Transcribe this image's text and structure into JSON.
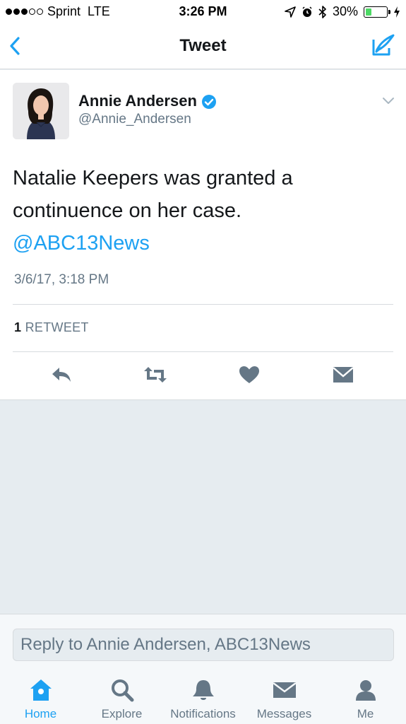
{
  "status_bar": {
    "carrier": "Sprint",
    "network": "LTE",
    "time": "3:26 PM",
    "battery_percent": "30%",
    "battery_level": 0.3,
    "signal_bars_on": 3,
    "signal_bars_total": 5
  },
  "nav": {
    "title": "Tweet",
    "back_icon": "chevron-left-icon",
    "compose_icon": "compose-tweet-icon"
  },
  "tweet": {
    "author_name": "Annie Andersen",
    "author_handle": "@Annie_Andersen",
    "verified": true,
    "text": "Natalie Keepers was granted a continuence on her case.",
    "mention": "@ABC13News",
    "timestamp": "3/6/17, 3:18 PM",
    "retweet_count": "1",
    "retweet_label": "RETWEET"
  },
  "actions": [
    {
      "name": "reply-icon"
    },
    {
      "name": "retweet-icon"
    },
    {
      "name": "like-icon"
    },
    {
      "name": "direct-message-icon"
    }
  ],
  "reply_bar": {
    "placeholder": "Reply to Annie Andersen, ABC13News"
  },
  "tabs": [
    {
      "label": "Home",
      "icon": "home-icon",
      "active": true
    },
    {
      "label": "Explore",
      "icon": "search-icon",
      "active": false
    },
    {
      "label": "Notifications",
      "icon": "bell-icon",
      "active": false
    },
    {
      "label": "Messages",
      "icon": "envelope-icon",
      "active": false
    },
    {
      "label": "Me",
      "icon": "person-icon",
      "active": false
    }
  ],
  "colors": {
    "accent": "#1da1f2",
    "text_primary": "#14171a",
    "text_secondary": "#657786",
    "icon_gray": "#657786",
    "background": "#e6ecf0"
  }
}
